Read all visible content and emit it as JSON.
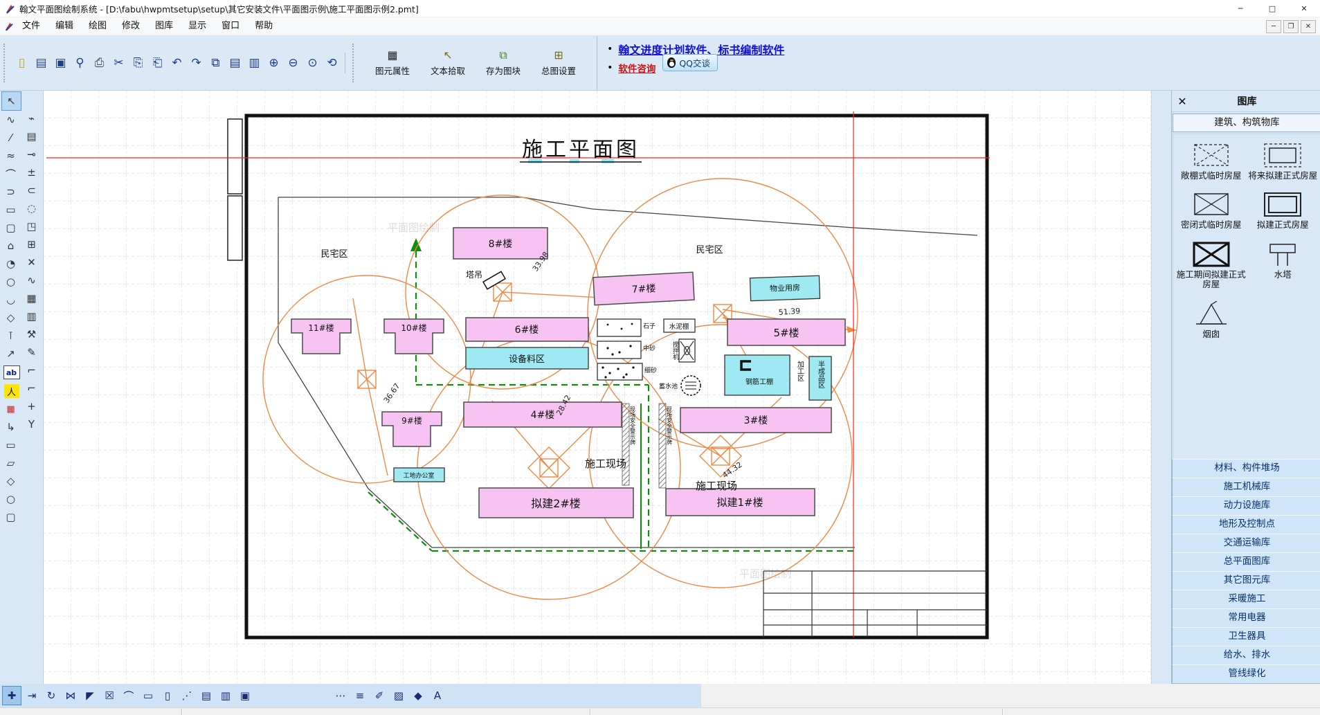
{
  "colors": {
    "toolbar_bg": "#dbe9f7",
    "sidebar_button": "#cfe5f8",
    "building_pink": "#f6c3f3",
    "area_cyan": "#9fe9f2",
    "crane_orange": "#f08843",
    "fence_green": "#0a8f0a",
    "crosshair_red": "#ff1f1f",
    "link_blue": "#1111d6",
    "link_red": "#cc1111"
  },
  "window": {
    "title": "翰文平面图绘制系统 - [D:\\fabu\\hwpmtsetup\\setup\\其它安装文件\\平面图示例\\施工平面图示例2.pmt]",
    "controls": {
      "minimize": "─",
      "maximize": "□",
      "close": "✕"
    }
  },
  "menu": {
    "items": [
      {
        "name": "menu-file",
        "label": "文件"
      },
      {
        "name": "menu-edit",
        "label": "编辑"
      },
      {
        "name": "menu-draw",
        "label": "绘图"
      },
      {
        "name": "menu-modify",
        "label": "修改"
      },
      {
        "name": "menu-library",
        "label": "图库"
      },
      {
        "name": "menu-display",
        "label": "显示"
      },
      {
        "name": "menu-window",
        "label": "窗口"
      },
      {
        "name": "menu-help",
        "label": "帮助"
      }
    ],
    "mdi": {
      "minimize": "─",
      "restore": "❐",
      "close": "✕"
    }
  },
  "toolbar": {
    "std_icons": [
      {
        "name": "new-file-icon",
        "glyph": "▯"
      },
      {
        "name": "open-file-icon",
        "glyph": "▤"
      },
      {
        "name": "save-file-icon",
        "glyph": "▣"
      },
      {
        "name": "print-preview-icon",
        "glyph": "⚲"
      },
      {
        "name": "print-icon",
        "glyph": "⎙"
      },
      {
        "name": "cut-icon",
        "glyph": "✂"
      },
      {
        "name": "copy-icon",
        "glyph": "⎘"
      },
      {
        "name": "paste-icon",
        "glyph": "⎗"
      },
      {
        "name": "undo-icon",
        "glyph": "↶"
      },
      {
        "name": "redo-icon",
        "glyph": "↷"
      },
      {
        "name": "cascade-windows-icon",
        "glyph": "⧉"
      },
      {
        "name": "tile-horizontal-icon",
        "glyph": "▤"
      },
      {
        "name": "tile-vertical-icon",
        "glyph": "▥"
      },
      {
        "name": "zoom-in-icon",
        "glyph": "⊕"
      },
      {
        "name": "zoom-out-icon",
        "glyph": "⊖"
      },
      {
        "name": "zoom-window-icon",
        "glyph": "⊙"
      },
      {
        "name": "zoom-refresh-icon",
        "glyph": "⟲"
      }
    ],
    "labeled_buttons": [
      {
        "name": "element-properties-button",
        "glyph": "▦",
        "label": "图元属性"
      },
      {
        "name": "text-pick-button",
        "glyph": "↖",
        "label": "文本拾取"
      },
      {
        "name": "save-as-block-button",
        "glyph": "⧉",
        "label": "存为图块"
      },
      {
        "name": "drawing-settings-button",
        "glyph": "⊞",
        "label": "总图设置"
      }
    ]
  },
  "links": {
    "promo": "翰文进度计划软件、标书编制软件",
    "consult": "软件咨询",
    "qq": "QQ交谈",
    "bullet": "•"
  },
  "left_toolbar": {
    "col1": [
      {
        "name": "select-tool",
        "glyph": "↖",
        "active": true
      },
      {
        "name": "polyline-tool",
        "glyph": "∿"
      },
      {
        "name": "construction-line-tool",
        "glyph": "⁄"
      },
      {
        "name": "spline-tool",
        "glyph": "≈"
      },
      {
        "name": "arc-tool",
        "glyph": "⌒"
      },
      {
        "name": "pipe-bend-tool",
        "glyph": "⊃"
      },
      {
        "name": "rectangle-tool",
        "glyph": "▭"
      },
      {
        "name": "rounded-rect-tool",
        "glyph": "▢"
      },
      {
        "name": "polygon-tool",
        "glyph": "⌂"
      },
      {
        "name": "circle-tool",
        "glyph": "◔"
      },
      {
        "name": "ellipse-tool",
        "glyph": "○"
      },
      {
        "name": "arch-tool",
        "glyph": "◡"
      },
      {
        "name": "wedge-tool",
        "glyph": "◇"
      },
      {
        "name": "dimension-tool",
        "glyph": "⊺"
      },
      {
        "name": "thick-arrow-tool",
        "glyph": "↗"
      },
      {
        "name": "text-tool",
        "glyph": "ab",
        "cls": "abox"
      },
      {
        "name": "walker-tool",
        "glyph": "人",
        "cls": "walker"
      },
      {
        "name": "legend-tool",
        "glyph": "▦",
        "cls": "legend"
      },
      {
        "name": "connector-tool",
        "glyph": "↳"
      },
      {
        "name": "flow-rect-tool",
        "glyph": "▭"
      },
      {
        "name": "flow-parallelogram-tool",
        "glyph": "▱"
      },
      {
        "name": "flow-diamond-tool",
        "glyph": "◇"
      },
      {
        "name": "flow-ellipse-tool",
        "glyph": "○"
      },
      {
        "name": "flow-stadium-tool",
        "glyph": "▢"
      }
    ],
    "col2": [
      {
        "name": "point-polyline-tool",
        "glyph": "⌁"
      },
      {
        "name": "hatch-tool",
        "glyph": "▤"
      },
      {
        "name": "leader-line-tool",
        "glyph": "⊸"
      },
      {
        "name": "tolerance-dim-tool",
        "glyph": "±"
      },
      {
        "name": "arc-segment-tool",
        "glyph": "⊂"
      },
      {
        "name": "sketch-circle-tool",
        "glyph": "◌"
      },
      {
        "name": "corner-rect-tool",
        "glyph": "◳"
      },
      {
        "name": "block-tool",
        "glyph": "⊞"
      },
      {
        "name": "erase-tool",
        "glyph": "✕"
      },
      {
        "name": "break-line-tool",
        "glyph": "∿"
      },
      {
        "name": "measure-tool",
        "glyph": "▦"
      },
      {
        "name": "scaffold-tool",
        "glyph": "▥"
      },
      {
        "name": "crane-tool",
        "glyph": "⚒"
      },
      {
        "name": "brush-tool",
        "glyph": "✎"
      },
      {
        "name": "corner-line-tool",
        "glyph": "⌐"
      },
      {
        "name": "curve-corner-tool",
        "glyph": "⌐"
      },
      {
        "name": "cross-junction-tool",
        "glyph": "+"
      },
      {
        "name": "wye-junction-tool",
        "glyph": "Y"
      }
    ]
  },
  "sidebar": {
    "title": "图库",
    "close_glyph": "✕",
    "tab": "建筑、构筑物库",
    "items": [
      {
        "label": "敞棚式临时房屋"
      },
      {
        "label": "将来拟建正式房屋"
      },
      {
        "label": "密闭式临时房屋"
      },
      {
        "label": "拟建正式房屋"
      },
      {
        "label": "施工期间拟建正式房屋"
      },
      {
        "label": "水塔"
      },
      {
        "label": "烟囱"
      }
    ],
    "categories": [
      {
        "name": "category-material-yards",
        "label": "材料、构件堆场"
      },
      {
        "name": "category-construction-machinery",
        "label": "施工机械库"
      },
      {
        "name": "category-power-facilities",
        "label": "动力设施库"
      },
      {
        "name": "category-terrain-control-points",
        "label": "地形及控制点"
      },
      {
        "name": "category-transportation",
        "label": "交通运输库"
      },
      {
        "name": "category-general-plan",
        "label": "总平面图库"
      },
      {
        "name": "category-other-elements",
        "label": "其它图元库"
      },
      {
        "name": "category-heating-construction",
        "label": "采暖施工"
      },
      {
        "name": "category-common-electrics",
        "label": "常用电器"
      },
      {
        "name": "category-sanitary-ware",
        "label": "卫生器具"
      },
      {
        "name": "category-water-supply-drainage",
        "label": "给水、排水"
      },
      {
        "name": "category-pipeline-greening",
        "label": "管线绿化"
      }
    ]
  },
  "canvas": {
    "texts": {
      "sheet_title": "施工平面图",
      "minzhai_left": "民宅区",
      "minzhai_right": "民宅区",
      "tadiao": "塔吊",
      "b8": "8#楼",
      "b7": "7#楼",
      "b6": "6#楼",
      "b5": "5#楼",
      "b4": "4#楼",
      "b3": "3#楼",
      "b11": "11#楼",
      "b10": "10#楼",
      "b9": "9#楼",
      "nb2": "拟建2#楼",
      "nb1": "拟建1#楼",
      "shebei": "设备料区",
      "wuye": "物业用房",
      "gangjin": "钢筋工棚",
      "bancheng": "半成品区",
      "jiagong": "加工区",
      "gongdi": "工地办公室",
      "shizi": "石子",
      "zhongsha": "中砂",
      "xisha": "细砂",
      "shuinipeng": "水泥棚",
      "jiaobanji": "搅拌机",
      "xushuichi": "蓄水池",
      "shigong1": "施工现场",
      "shigong2": "施工现场",
      "dim1": "33.98",
      "dim2": "51.39",
      "dim3": "36.67",
      "dim4": "44.32",
      "dim5": "28.42",
      "sign1": "现场安全警示牌",
      "sign2": "现场安全警示牌",
      "watermark1": "平面图绘制",
      "watermark2": "平面图绘制"
    }
  },
  "bottom_toolbar": {
    "icons": [
      {
        "name": "move-tool",
        "glyph": "✚",
        "active": true
      },
      {
        "name": "offset-tool",
        "glyph": "⇥"
      },
      {
        "name": "rotate-tool",
        "glyph": "↻"
      },
      {
        "name": "mirror-tool",
        "glyph": "⋈"
      },
      {
        "name": "corner-trim-tool",
        "glyph": "◤"
      },
      {
        "name": "delete-tool",
        "glyph": "☒"
      },
      {
        "name": "fillet-tool",
        "glyph": "⌒"
      },
      {
        "name": "stretch-rect-tool",
        "glyph": "▭"
      },
      {
        "name": "scale-rect-tool",
        "glyph": "▯"
      },
      {
        "name": "measure-line-tool",
        "glyph": "⋰"
      },
      {
        "name": "send-back-tool",
        "glyph": "▤"
      },
      {
        "name": "bring-front-tool",
        "glyph": "▥"
      },
      {
        "name": "group-select-tool",
        "glyph": "▣",
        "gap_after": true
      },
      {
        "name": "line-style-button",
        "glyph": "⋯"
      },
      {
        "name": "line-width-button",
        "glyph": "≡"
      },
      {
        "name": "pen-style-button",
        "glyph": "✐"
      },
      {
        "name": "hatch-style-button",
        "glyph": "▨"
      },
      {
        "name": "fill-color-button",
        "glyph": "◆"
      },
      {
        "name": "text-style-button",
        "glyph": "A"
      }
    ]
  }
}
